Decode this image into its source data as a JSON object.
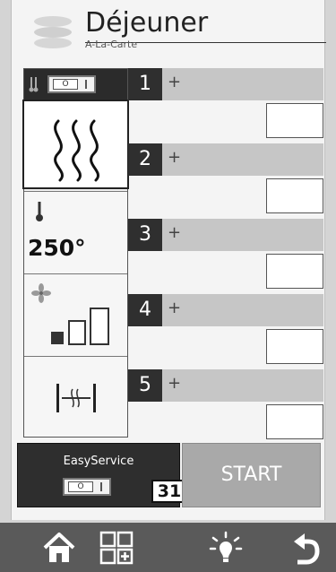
{
  "header": {
    "title": "Déjeuner",
    "subtitle": "A-La-Carte"
  },
  "heating": {
    "toggle_label": "O"
  },
  "mode": {
    "temperature": "250°"
  },
  "slots": [
    {
      "number": "1",
      "add": "+"
    },
    {
      "number": "2",
      "add": "+"
    },
    {
      "number": "3",
      "add": "+"
    },
    {
      "number": "4",
      "add": "+"
    },
    {
      "number": "5",
      "add": "+"
    }
  ],
  "easy_service": {
    "label": "EasyService",
    "toggle_label": "O",
    "counter": "31"
  },
  "start": {
    "label": "START"
  },
  "nav": {
    "items": [
      "home-icon",
      "grid-plus-icon",
      "light-icon",
      "back-icon"
    ]
  },
  "colors": {
    "dark": "#2e2e2e",
    "start_bg": "#a9a9a9",
    "nav_bg": "#5a5a5a",
    "slot_bar": "#c6c6c6"
  }
}
